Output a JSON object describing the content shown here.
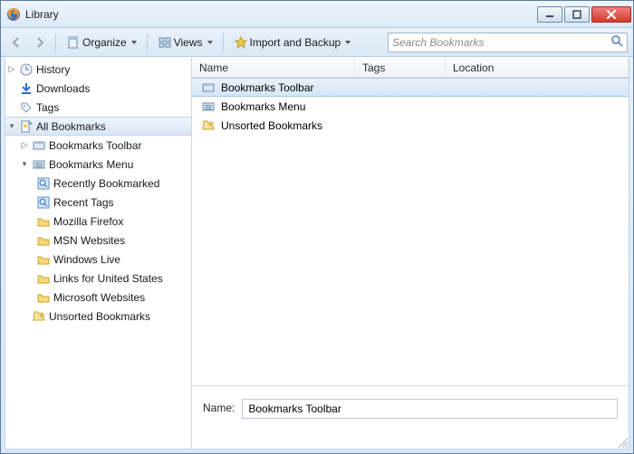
{
  "window": {
    "title": "Library"
  },
  "toolbar": {
    "organize": "Organize",
    "views": "Views",
    "import_backup": "Import and Backup"
  },
  "search": {
    "placeholder": "Search Bookmarks"
  },
  "sidebar": {
    "history": "History",
    "downloads": "Downloads",
    "tags": "Tags",
    "all_bookmarks": "All Bookmarks",
    "toolbar": "Bookmarks Toolbar",
    "menu": "Bookmarks Menu",
    "recently": "Recently Bookmarked",
    "recent_tags": "Recent Tags",
    "mozilla": "Mozilla Firefox",
    "msn": "MSN Websites",
    "winlive": "Windows Live",
    "links_us": "Links for United States",
    "ms_web": "Microsoft Websites",
    "unsorted": "Unsorted Bookmarks"
  },
  "columns": {
    "name": "Name",
    "tags": "Tags",
    "location": "Location"
  },
  "list": {
    "item0": "Bookmarks Toolbar",
    "item1": "Bookmarks Menu",
    "item2": "Unsorted Bookmarks"
  },
  "details": {
    "name_label": "Name:",
    "name_value": "Bookmarks Toolbar"
  }
}
